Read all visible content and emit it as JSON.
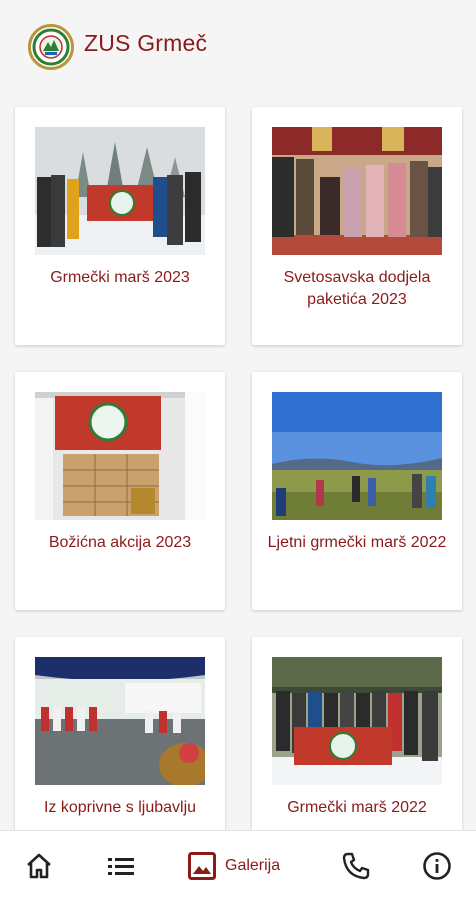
{
  "header": {
    "title": "ZUS Grmeč",
    "logo_icon": "zus-grmec-emblem"
  },
  "gallery": [
    {
      "title": "Grmečki marš 2023",
      "image": "group-with-banner-in-snow"
    },
    {
      "title": "Svetosavska dodjela paketića 2023",
      "image": "children-in-church-hall"
    },
    {
      "title": "Božićna akcija 2023",
      "image": "van-with-boxes-and-banner"
    },
    {
      "title": "Ljetni grmečki marš 2022",
      "image": "hikers-on-meadow"
    },
    {
      "title": "Iz koprivne s ljubavlju",
      "image": "folk-dancers-under-tent"
    },
    {
      "title": "Grmečki marš 2022",
      "image": "large-group-with-banner-in-snow"
    }
  ],
  "bottom_nav": {
    "home_icon": "home-icon",
    "list_icon": "list-icon",
    "gallery_icon": "image-icon",
    "gallery_label": "Galerija",
    "phone_icon": "phone-icon",
    "info_icon": "info-icon"
  },
  "colors": {
    "brand": "#8b1a1a",
    "background": "#f5f5f5",
    "card": "#ffffff",
    "icon": "#222222"
  }
}
